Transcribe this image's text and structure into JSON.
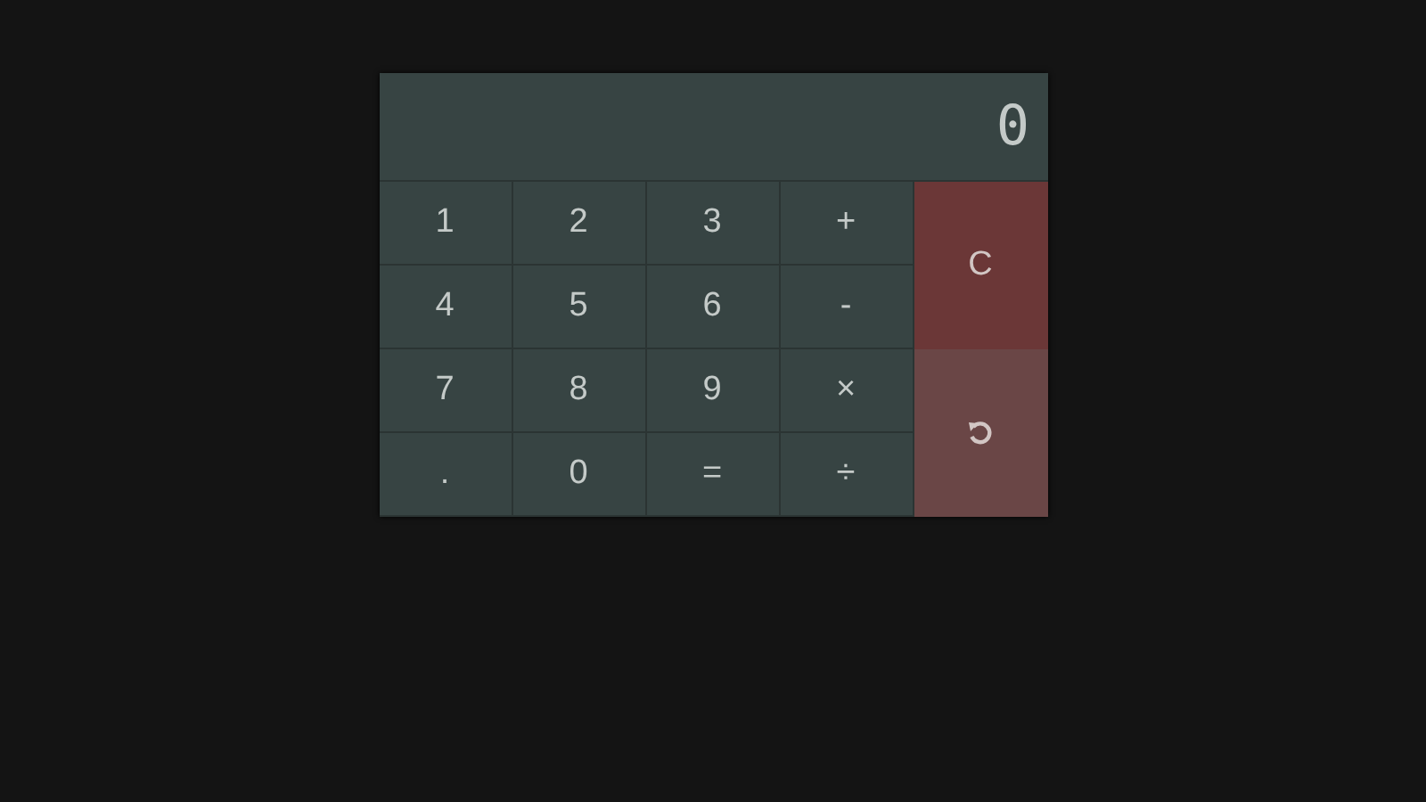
{
  "display": "0",
  "keys": [
    "1",
    "2",
    "3",
    "+",
    "4",
    "5",
    "6",
    "-",
    "7",
    "8",
    "9",
    "×",
    ".",
    "0",
    "=",
    "÷"
  ],
  "side_keys": [
    {
      "kind": "clear",
      "label": "C"
    },
    {
      "kind": "undo"
    }
  ]
}
